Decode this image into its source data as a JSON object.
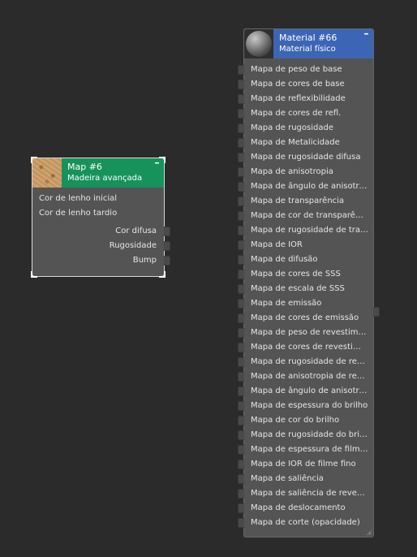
{
  "map_node": {
    "title": "Map #6",
    "subtitle": "Madeira avançada",
    "minimize_label": "–",
    "thumbnail_icon": "wood-texture-thumbnail",
    "header_color": "#16925a",
    "inputs": [
      "Cor de lenho inicial",
      "Cor de lenho tardio"
    ],
    "outputs": [
      "Cor difusa",
      "Rugosidade",
      "Bump"
    ]
  },
  "material_node": {
    "title": "Material #66",
    "subtitle": "Material físico",
    "minimize_label": "–",
    "thumbnail_icon": "material-sphere-thumbnail",
    "header_color": "#3d65b5",
    "inputs": [
      "Mapa de peso de base",
      "Mapa de cores de base",
      "Mapa de reflexibilidade",
      "Mapa de cores de refl.",
      "Mapa de rugosidade",
      "Mapa de Metalicidade",
      "Mapa de rugosidade difusa",
      "Mapa de anisotropia",
      "Mapa de ângulo de anisotropia",
      "Mapa de transparência",
      "Mapa de cor de transparência",
      "Mapa de rugosidade de transparência",
      "Mapa de IOR",
      "Mapa de difusão",
      "Mapa de cores de SSS",
      "Mapa de escala de SSS",
      "Mapa de emissão",
      "Mapa de cores de emissão",
      "Mapa de peso de revestimento",
      "Mapa de cores de revestimento",
      "Mapa de rugosidade de revestimento",
      "Mapa de anisotropia de revestimento",
      "Mapa de ângulo de anisotropia de revestimento",
      "Mapa de espessura do brilho",
      "Mapa de cor do brilho",
      "Mapa de rugosidade do brilho",
      "Mapa de espessura de filme fino",
      "Mapa de IOR de filme fino",
      "Mapa de saliência",
      "Mapa de saliência de revestimento",
      "Mapa de deslocamento",
      "Mapa de corte (opacidade)"
    ]
  },
  "colors": {
    "background": "#2b2b2b",
    "node_body": "#545454",
    "selection_outline": "#d8d8d8"
  }
}
